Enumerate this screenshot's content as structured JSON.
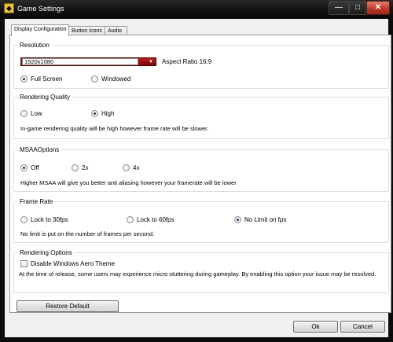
{
  "window": {
    "title": "Game Settings",
    "app_icon": "game-logo-icon",
    "minimize_glyph": "—",
    "maximize_glyph": "□",
    "close_glyph": "✕"
  },
  "tabs": [
    {
      "label": "Display Configuration",
      "active": true
    },
    {
      "label": "Button Icons",
      "active": false
    },
    {
      "label": "Audio",
      "active": false
    }
  ],
  "resolution": {
    "title": "Resolution",
    "selected": "1920x1080",
    "aspect_ratio": "Aspect Ratio 16:9",
    "options": [
      {
        "label": "Full Screen",
        "checked": true
      },
      {
        "label": "Windowed",
        "checked": false
      }
    ]
  },
  "rendering_quality": {
    "title": "Rendering Quality",
    "options": [
      {
        "label": "Low",
        "checked": false
      },
      {
        "label": "High",
        "checked": true
      }
    ],
    "description": "In-game rendering quality will be high however frame rate will be slower."
  },
  "msaa": {
    "title": "MSAAOptions",
    "options": [
      {
        "label": "Off",
        "checked": true
      },
      {
        "label": "2x",
        "checked": false
      },
      {
        "label": "4x",
        "checked": false
      }
    ],
    "description": "Higher MSAA will give you better anti aliasing however your framerate will be lower"
  },
  "frame_rate": {
    "title": "Frame Rate",
    "options": [
      {
        "label": "Lock to 30fps",
        "checked": false
      },
      {
        "label": "Lock to 60fps",
        "checked": false
      },
      {
        "label": "No Limit on fps",
        "checked": true
      }
    ],
    "description": "No limit is put on the number of frames per second."
  },
  "rendering_options": {
    "title": "Rendering Options",
    "checkbox_label": "Disable Windows Aero Theme",
    "checked": false,
    "description": "At the time of release, some users may experience micro stuttering during gameplay. By enabling this option your issue may be resolved."
  },
  "buttons": {
    "restore_default": "Restore Default",
    "ok": "Ok",
    "cancel": "Cancel"
  },
  "colors": {
    "combo_accent": "#9b1414",
    "radio_dot": "#1f3c66",
    "titlebar": "#111111"
  }
}
